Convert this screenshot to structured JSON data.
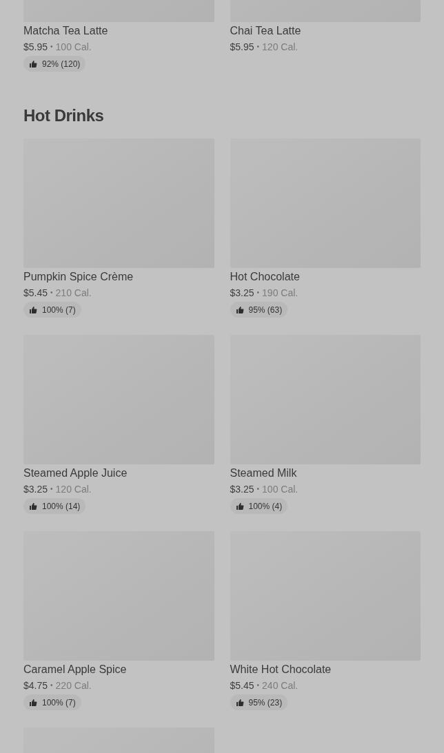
{
  "sections": [
    {
      "items": [
        {
          "image": true,
          "name": "Matcha Tea Latte",
          "price": "$5.95",
          "separator": "•",
          "calories": "100 Cal.",
          "rating": "92% (120)"
        },
        {
          "image": true,
          "name": "Chai Tea Latte",
          "price": "$5.95",
          "separator": "•",
          "calories": "120 Cal."
        }
      ]
    },
    {
      "title": "Hot Drinks",
      "items": [
        {
          "image": true,
          "name": "Pumpkin Spice Crème",
          "price": "$5.45",
          "separator": "•",
          "calories": "210 Cal.",
          "rating": "100% (7)"
        },
        {
          "image": true,
          "name": "Hot Chocolate",
          "price": "$3.25",
          "separator": "•",
          "calories": "190 Cal.",
          "rating": "95% (63)"
        },
        {
          "image": true,
          "name": "Steamed Apple Juice",
          "price": "$3.25",
          "separator": "•",
          "calories": "120 Cal.",
          "rating": "100% (14)"
        },
        {
          "image": true,
          "name": "Steamed Milk",
          "price": "$3.25",
          "separator": "•",
          "calories": "100 Cal.",
          "rating": "100% (4)"
        },
        {
          "image": true,
          "name": "Caramel Apple Spice",
          "price": "$4.75",
          "separator": "•",
          "calories": "220 Cal.",
          "rating": "100% (7)"
        },
        {
          "image": true,
          "name": "White Hot Chocolate",
          "price": "$5.45",
          "separator": "•",
          "calories": "240 Cal.",
          "rating": "95% (23)"
        },
        {
          "image": true
        }
      ]
    }
  ]
}
